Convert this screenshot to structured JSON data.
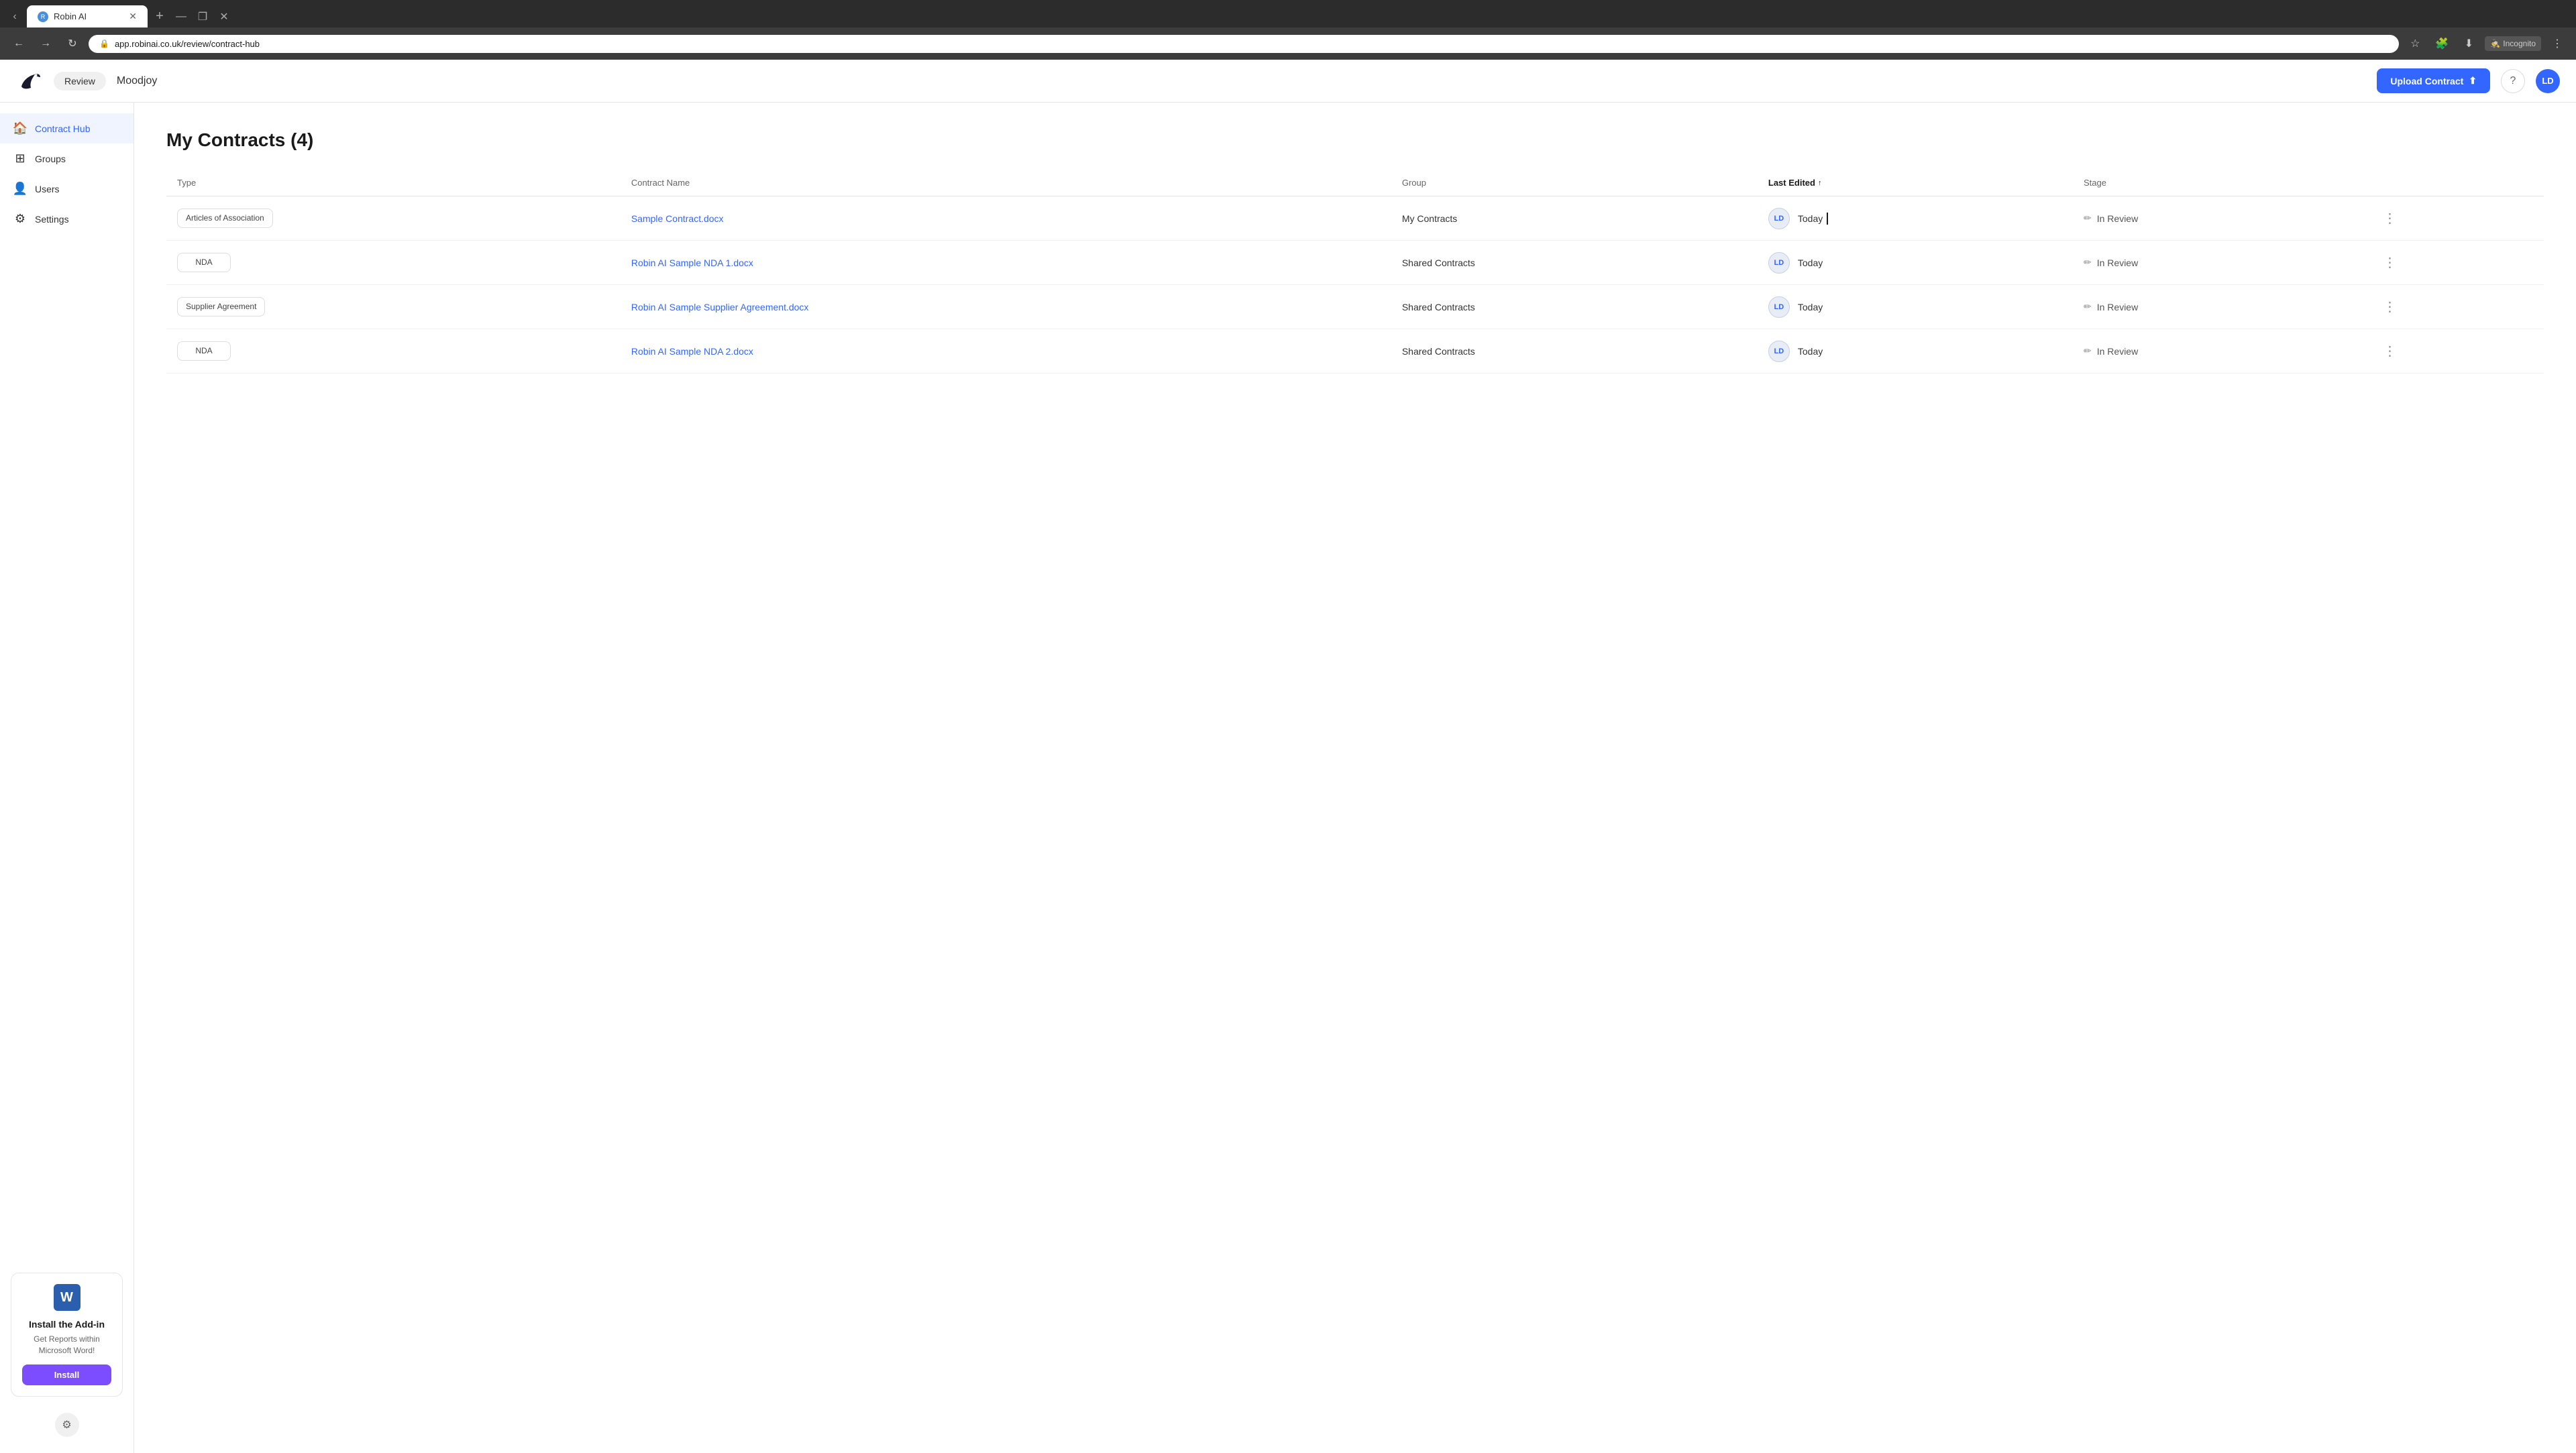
{
  "browser": {
    "tab_title": "Robin AI",
    "url": "app.robinai.co.uk/review/contract-hub",
    "new_tab_label": "+",
    "back_label": "←",
    "forward_label": "→",
    "refresh_label": "↻",
    "incognito_label": "Incognito",
    "bookmark_icon": "☆",
    "downloads_icon": "⬇",
    "extensions_icon": "🧩",
    "menu_icon": "⋮"
  },
  "topnav": {
    "review_label": "Review",
    "org_name": "Moodjoy",
    "upload_btn_label": "Upload Contract",
    "upload_icon": "⬆",
    "help_icon": "?",
    "user_initials": "LD"
  },
  "sidebar": {
    "items": [
      {
        "id": "contract-hub",
        "label": "Contract Hub",
        "icon": "🏠",
        "active": true
      },
      {
        "id": "groups",
        "label": "Groups",
        "icon": "⊞",
        "active": false
      },
      {
        "id": "users",
        "label": "Users",
        "icon": "👤",
        "active": false
      },
      {
        "id": "settings",
        "label": "Settings",
        "icon": "⚙",
        "active": false
      }
    ],
    "addin": {
      "word_icon": "W",
      "title": "Install the Add-in",
      "description": "Get Reports within Microsoft Word!",
      "install_label": "Install"
    },
    "bottom_icon": "⚙"
  },
  "main": {
    "page_title": "My Contracts (4)",
    "table": {
      "columns": [
        {
          "id": "type",
          "label": "Type"
        },
        {
          "id": "contract_name",
          "label": "Contract Name"
        },
        {
          "id": "group",
          "label": "Group"
        },
        {
          "id": "last_edited",
          "label": "Last Edited",
          "sort": "↑",
          "sorted": true
        },
        {
          "id": "stage",
          "label": "Stage"
        }
      ],
      "rows": [
        {
          "type": "Articles of Association",
          "contract_name": "Sample Contract.docx",
          "group": "My Contracts",
          "user_initials": "LD",
          "last_edited": "Today",
          "stage": "In Review"
        },
        {
          "type": "NDA",
          "contract_name": "Robin AI Sample NDA 1.docx",
          "group": "Shared Contracts",
          "user_initials": "LD",
          "last_edited": "Today",
          "stage": "In Review"
        },
        {
          "type": "Supplier Agreement",
          "contract_name": "Robin AI Sample Supplier Agreement.docx",
          "group": "Shared Contracts",
          "user_initials": "LD",
          "last_edited": "Today",
          "stage": "In Review"
        },
        {
          "type": "NDA",
          "contract_name": "Robin AI Sample NDA 2.docx",
          "group": "Shared Contracts",
          "user_initials": "LD",
          "last_edited": "Today",
          "stage": "In Review"
        }
      ]
    }
  }
}
